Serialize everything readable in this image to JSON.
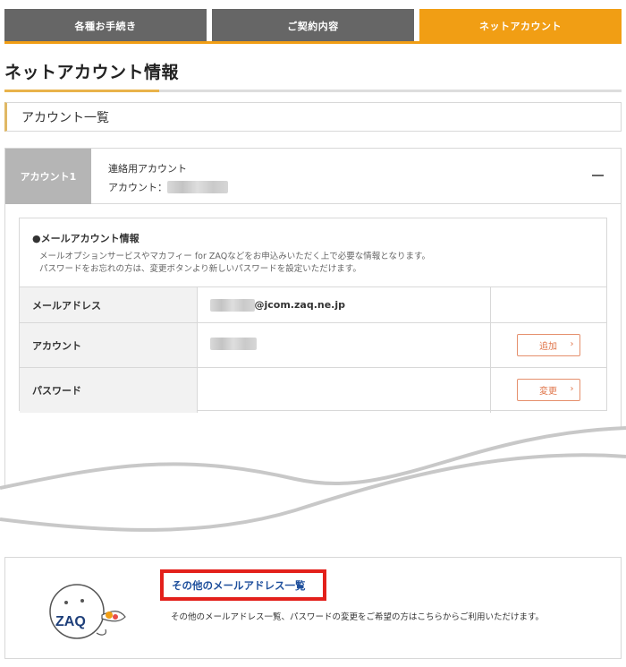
{
  "tabs": [
    {
      "label": "各種お手続き",
      "active": false
    },
    {
      "label": "ご契約内容",
      "active": false
    },
    {
      "label": "ネットアカウント",
      "active": true
    }
  ],
  "page_title": "ネットアカウント情報",
  "section_title": "アカウント一覧",
  "account": {
    "badge": "アカウント1",
    "type": "連絡用アカウント",
    "account_label": "アカウント："
  },
  "mail_info": {
    "title": "●メールアカウント情報",
    "desc_line1": "メールオプションサービスやマカフィー for ZAQなどをお申込みいただく上で必要な情報となります。",
    "desc_line2": "パスワードをお忘れの方は、変更ボタンより新しいパスワードを設定いただけます。",
    "rows": {
      "email_label": "メールアドレス",
      "email_suffix": "@jcom.zaq.ne.jp",
      "account_label": "アカウント",
      "account_button": "追加",
      "password_label": "パスワード",
      "password_button": "変更"
    }
  },
  "other": {
    "link": "その他のメールアドレス一覧",
    "desc": "その他のメールアドレス一覧、パスワードの変更をご希望の方はこちらからご利用いただけます。",
    "logo_text": "ZAQ"
  },
  "colors": {
    "accent_orange": "#f19e14",
    "tab_dark": "#666666",
    "button_orange": "#e0764b",
    "link_blue": "#1e4f9c",
    "highlight_red": "#e3201b"
  }
}
